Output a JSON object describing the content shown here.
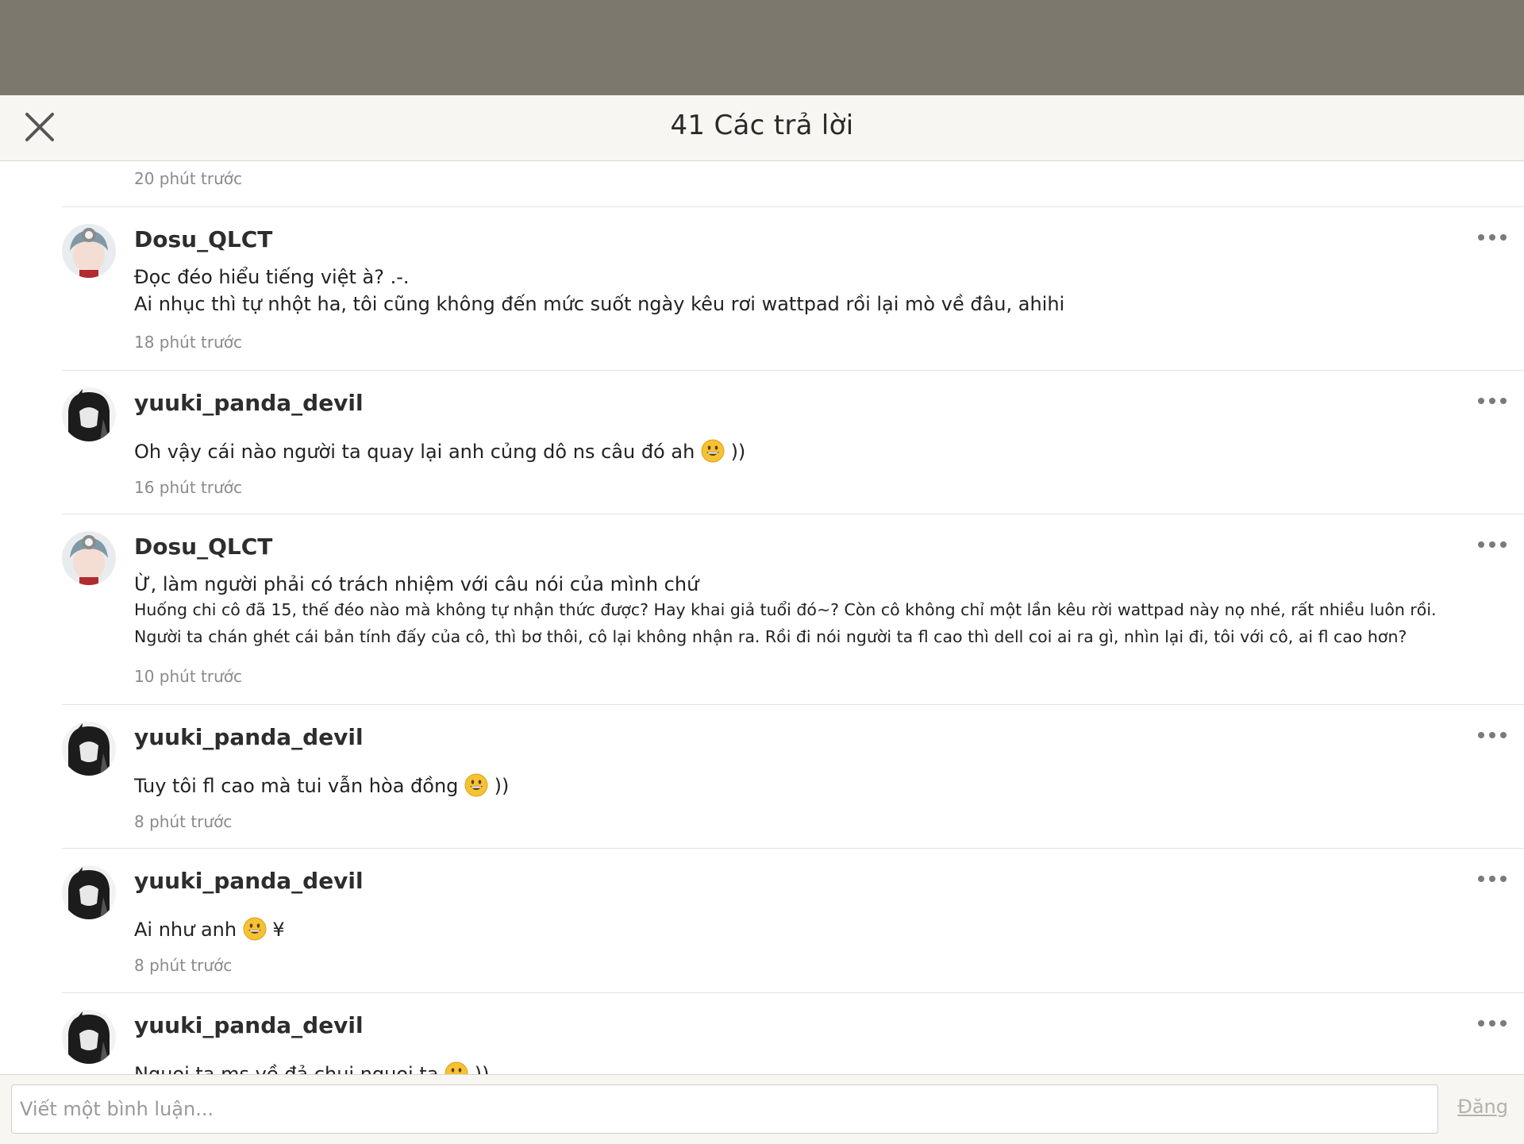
{
  "header": {
    "title": "41 Các trả lời"
  },
  "first_time": "20 phút trước",
  "comments": [
    {
      "user": "Dosu_QLCT",
      "avatar": "avatar-dosu",
      "lines": [
        "Đọc đéo hiểu tiếng việt à? .-.",
        "Ai nhục thì tự nhột ha, tôi cũng không đến mức suốt ngày kêu rơi wattpad rồi lại mò về đâu, ahihi"
      ],
      "time": "18 phút trước"
    },
    {
      "user": "yuuki_panda_devil",
      "avatar": "avatar-yuuki",
      "lines": [
        "Oh vậy cái nào người ta quay lại anh củng dô ns câu đó ah"
      ],
      "suffix": "))",
      "time": "16 phút trước"
    },
    {
      "user": "Dosu_QLCT",
      "avatar": "avatar-dosu",
      "lines": [
        "Ừ, làm người phải có trách nhiệm với câu nói của mình chứ",
        "Huống chi cô đã 15, thế đéo nào mà không tự nhận thức được? Hay khai giả tuổi đó~? Còn cô không chỉ một lần kêu rời wattpad này nọ nhé, rất nhiều luôn rồi.",
        "Người ta chán ghét cái bản tính đấy của cô, thì bơ thôi, cô lại không nhận ra. Rồi đi nói người ta fl cao thì dell coi ai ra gì, nhìn lại đi, tôi với cô, ai fl cao hơn?"
      ],
      "time": "10 phút trước"
    },
    {
      "user": "yuuki_panda_devil",
      "avatar": "avatar-yuuki",
      "lines": [
        "Tuy tôi fl cao mà tui vẫn hòa đồng"
      ],
      "suffix": "))",
      "time": "8 phút trước"
    },
    {
      "user": "yuuki_panda_devil",
      "avatar": "avatar-yuuki",
      "lines": [
        "Ai như anh"
      ],
      "suffix": "¥",
      "time": "8 phút trước"
    },
    {
      "user": "yuuki_panda_devil",
      "avatar": "avatar-yuuki",
      "lines": [
        "Nguoi ta ms về đả chui nguoi ta"
      ],
      "suffix": "))",
      "time": ""
    }
  ],
  "composer": {
    "placeholder": "Viết một bình luận...",
    "post_label": "Đăng"
  },
  "colors": {
    "top_overlay": "#7c786d",
    "header_bg": "#f7f6f3",
    "divider": "#e4e2dd",
    "timestamp": "#8a8a8a",
    "post_disabled": "#b4b2ac"
  },
  "icons": {
    "close": "close-icon",
    "more": "more-options-icon",
    "emoji": "grinning-face-emoji"
  }
}
